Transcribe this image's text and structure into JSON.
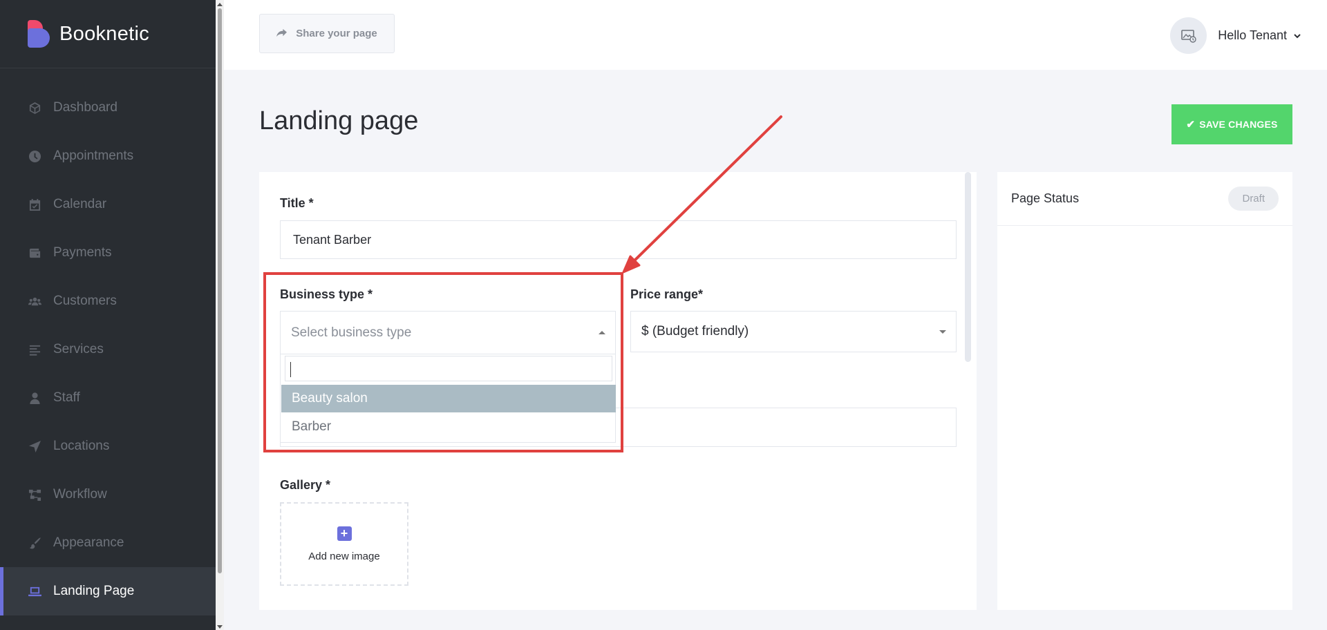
{
  "brand": {
    "name": "Booknetic"
  },
  "sidebar": {
    "items": [
      {
        "label": "Dashboard",
        "icon": "dashboard-icon"
      },
      {
        "label": "Appointments",
        "icon": "clock-icon"
      },
      {
        "label": "Calendar",
        "icon": "calendar-icon"
      },
      {
        "label": "Payments",
        "icon": "wallet-icon"
      },
      {
        "label": "Customers",
        "icon": "users-icon"
      },
      {
        "label": "Services",
        "icon": "list-icon"
      },
      {
        "label": "Staff",
        "icon": "person-icon"
      },
      {
        "label": "Locations",
        "icon": "location-arrow-icon"
      },
      {
        "label": "Workflow",
        "icon": "workflow-icon"
      },
      {
        "label": "Appearance",
        "icon": "brush-icon"
      },
      {
        "label": "Landing Page",
        "icon": "laptop-icon",
        "active": true
      }
    ]
  },
  "header": {
    "share_label": "Share your page",
    "user_greeting": "Hello Tenant"
  },
  "page": {
    "title": "Landing page",
    "save_label": "SAVE CHANGES"
  },
  "form": {
    "title_label": "Title *",
    "title_value": "Tenant Barber",
    "business_type_label": "Business type *",
    "business_type_placeholder": "Select business type",
    "business_type_options": [
      "Beauty salon",
      "Barber"
    ],
    "price_range_label": "Price range*",
    "price_range_value": "$ (Budget friendly)",
    "gallery_label": "Gallery *",
    "add_image_label": "Add new image"
  },
  "status": {
    "title": "Page Status",
    "badge": "Draft"
  },
  "colors": {
    "sidebar_bg": "#292d32",
    "accent": "#6c70dc",
    "save_green": "#53d56c",
    "annotation_red": "#e0413f",
    "option_highlight": "#aabbc4"
  }
}
